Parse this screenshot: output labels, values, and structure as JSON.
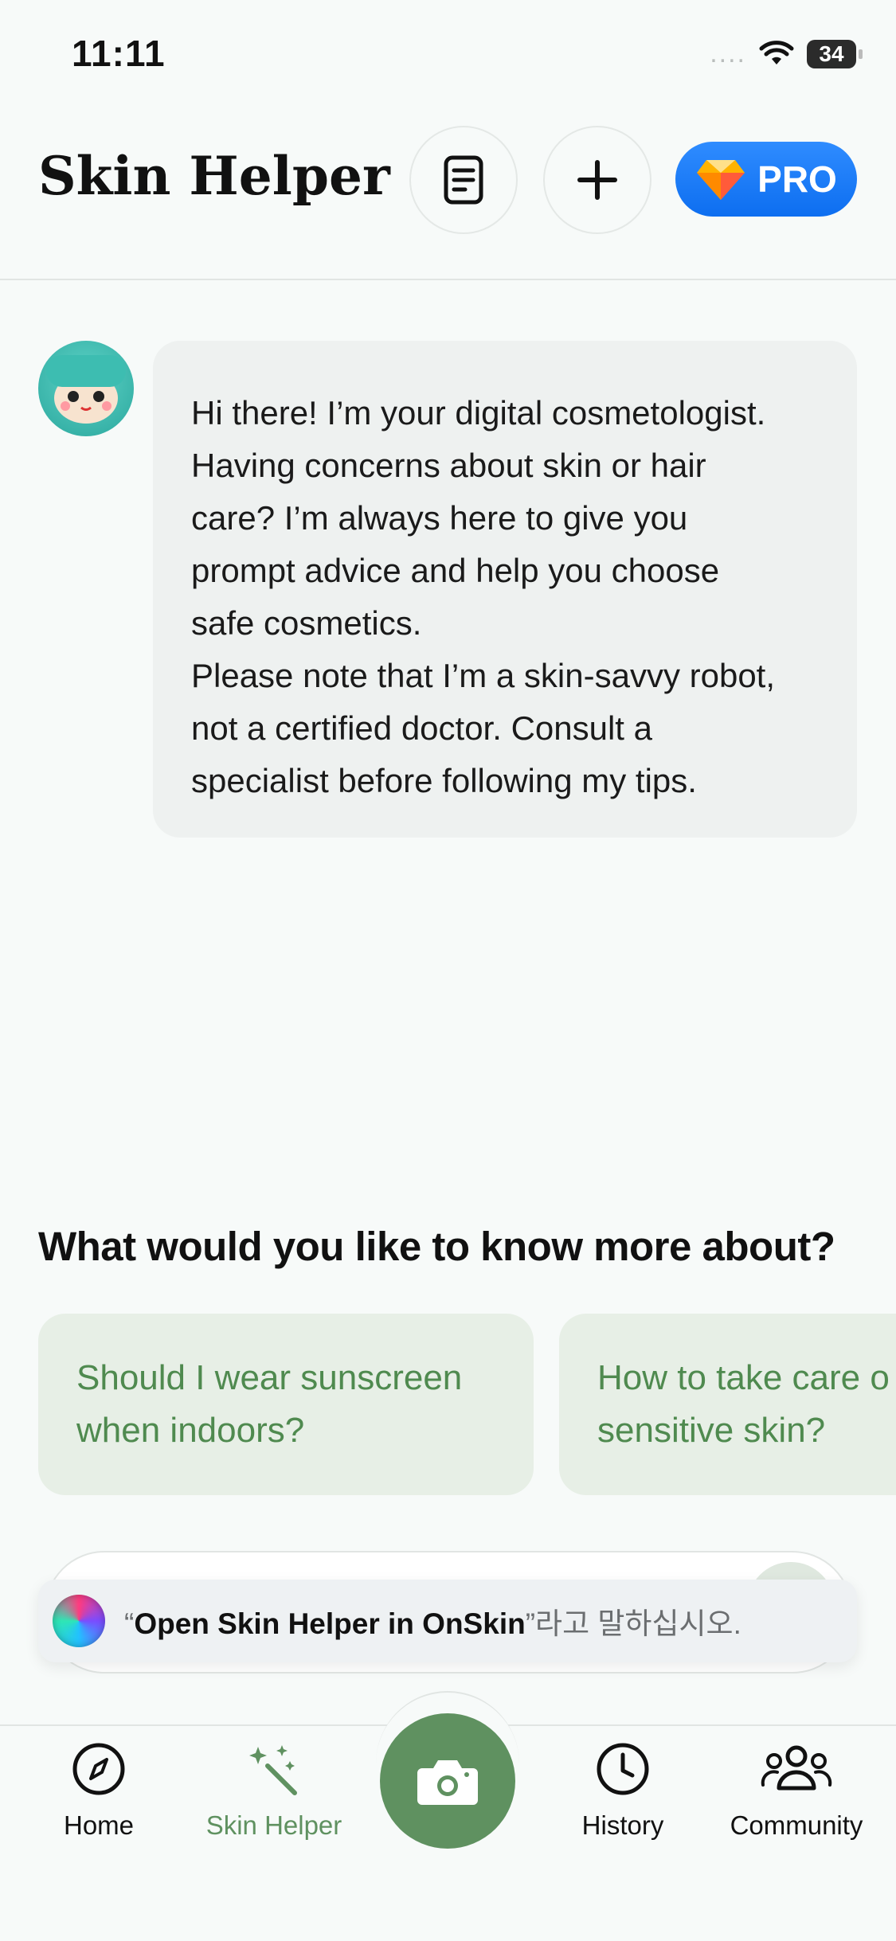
{
  "status_bar": {
    "time": "11:11",
    "signal": "....",
    "battery": "34"
  },
  "header": {
    "title": "Skin Helper",
    "pro_label": "PRO"
  },
  "chat": {
    "message_lines": [
      "Hi there! I’m your digital cosmetologist.",
      "Having concerns about skin or hair",
      "care? I’m always here to give you",
      "prompt advice and help you choose",
      "safe cosmetics.",
      "Please note that I’m a skin-savvy robot,",
      "not a certified doctor. Consult a",
      "specialist before following my tips."
    ]
  },
  "suggestions": {
    "title": "What would you like to know more about?",
    "items": [
      {
        "line1": "Should I wear sunscreen",
        "line2": "when indoors?"
      },
      {
        "line1": "How to take care o",
        "line2": "sensitive skin?"
      }
    ]
  },
  "siri": {
    "prefix": "“",
    "phrase": "Open Skin Helper in OnSkin",
    "suffix": "”라고 말하십시오."
  },
  "tabbar": {
    "home": "Home",
    "skin_helper": "Skin Helper",
    "history": "History",
    "community": "Community"
  },
  "colors": {
    "accent": "#5f9160",
    "pro": "#1f7ef8",
    "chip_bg": "#e7efe6",
    "chip_text": "#4f8a4f"
  }
}
